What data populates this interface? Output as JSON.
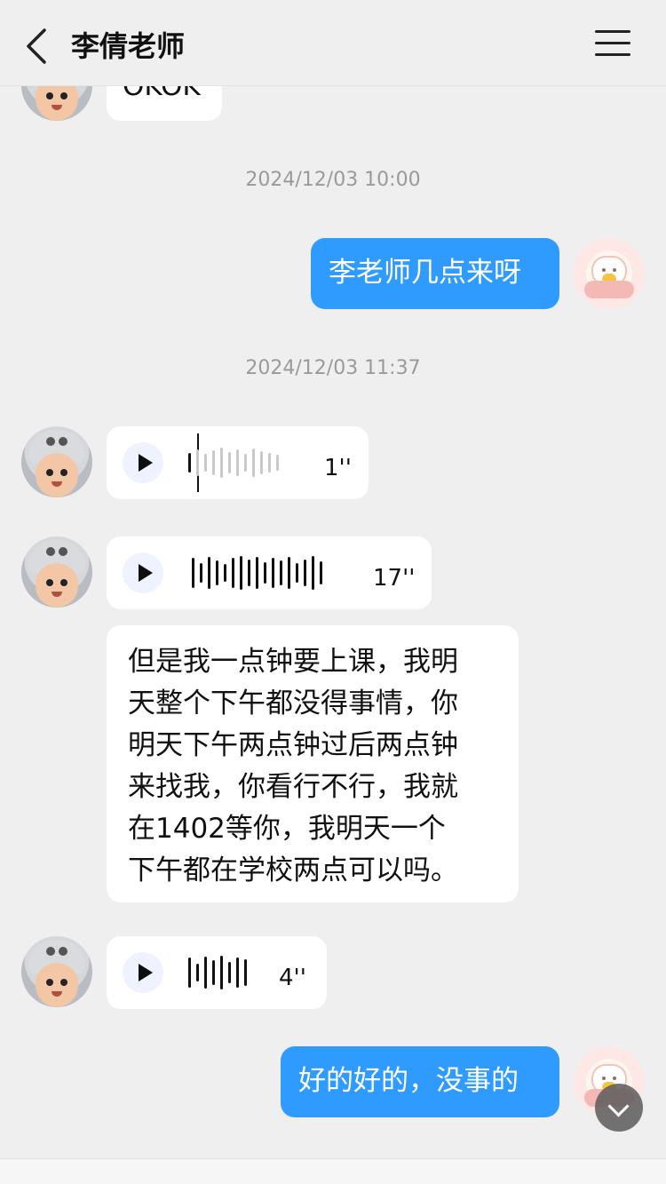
{
  "header": {
    "title": "李倩老师",
    "back_icon": "chevron-left-icon",
    "menu_icon": "hamburger-menu-icon"
  },
  "messages": {
    "partial_top": {
      "text": "OKOK"
    },
    "time1": "2024/12/03 10:00",
    "out1": "李老师几点来呀",
    "time2": "2024/12/03 11:37",
    "voice1": {
      "duration": "1''"
    },
    "voice2": {
      "duration": "17''"
    },
    "text_in": "但是我一点钟要上课，我明\n天整个下午都没得事情，你\n明天下午两点钟过后两点钟\n来找我，你看行不行，我就\n在1402等你，我明天一个\n下午都在学校两点可以吗。",
    "voice3": {
      "duration": "4''"
    },
    "out2": "好的好的，没事的"
  },
  "colors": {
    "accent_blue": "#2f9bff",
    "bg": "#efefef",
    "bubble_in": "#ffffff",
    "time_gray": "#9a9a9a"
  }
}
